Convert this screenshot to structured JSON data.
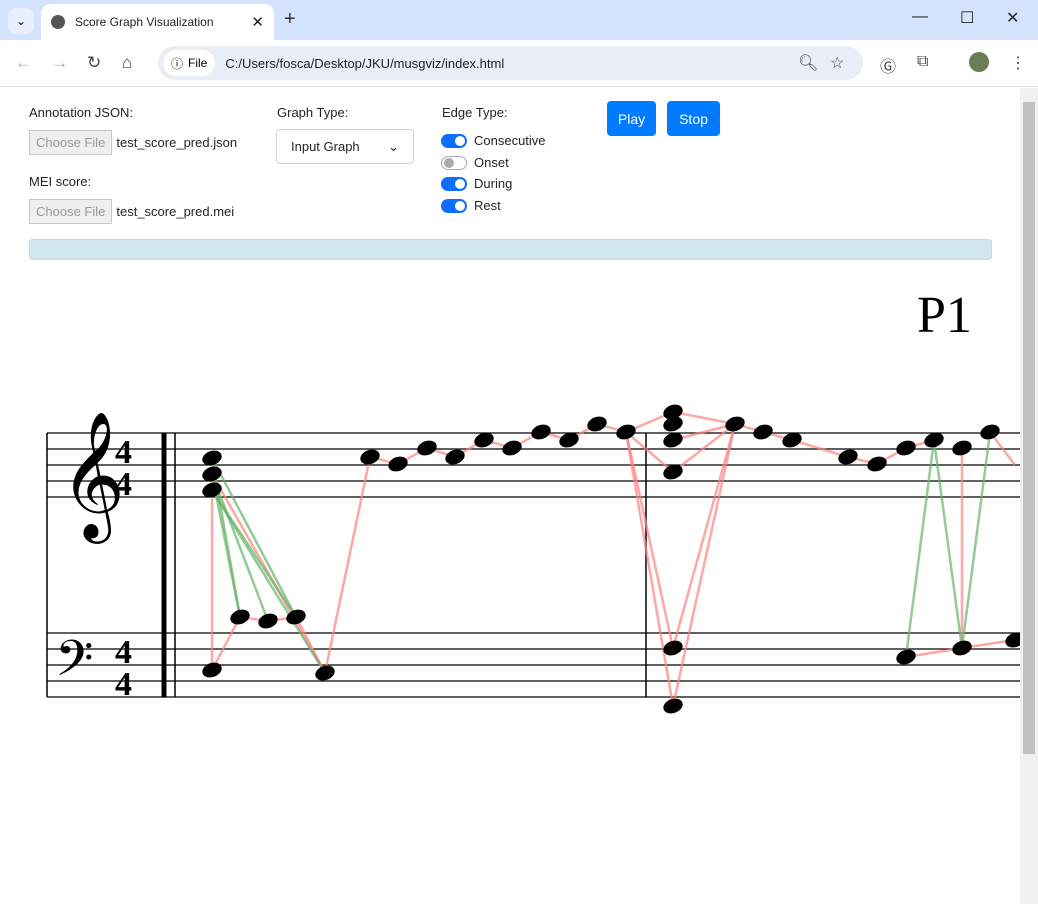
{
  "browser": {
    "tab_title": "Score Graph Visualization",
    "url": "C:/Users/fosca/Desktop/JKU/musgviz/index.html",
    "chip": "File"
  },
  "controls": {
    "annotation_label": "Annotation JSON:",
    "annotation_button": "Choose File",
    "annotation_file": "test_score_pred.json",
    "mei_label": "MEI score:",
    "mei_button": "Choose File",
    "mei_file": "test_score_pred.mei",
    "graph_type_label": "Graph Type:",
    "graph_type_value": "Input Graph",
    "edge_type_label": "Edge Type:",
    "edges": [
      {
        "label": "Consecutive",
        "on": true
      },
      {
        "label": "Onset",
        "on": false
      },
      {
        "label": "During",
        "on": true
      },
      {
        "label": "Rest",
        "on": true
      }
    ],
    "play": "Play",
    "stop": "Stop"
  },
  "score": {
    "part_label": "P1",
    "time_signature": "4/4",
    "edge_colors": {
      "consecutive": "#ff8080",
      "during": "#66b366"
    }
  }
}
